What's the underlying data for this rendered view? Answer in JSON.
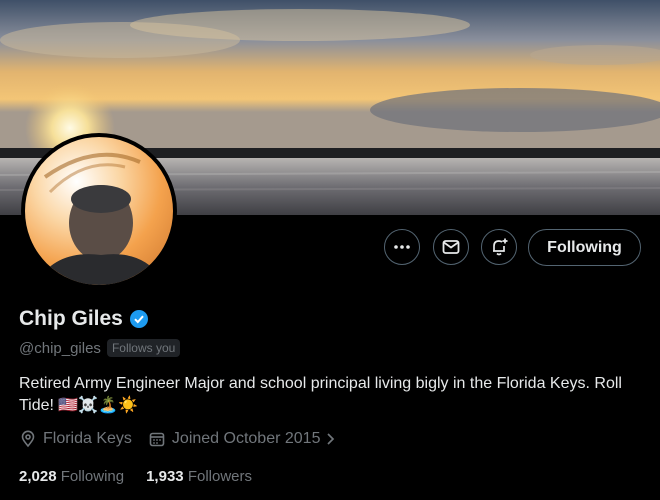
{
  "profile": {
    "name": "Chip Giles",
    "handle": "@chip_giles",
    "follows_you": "Follows you",
    "bio": "Retired Army Engineer Major and school principal living bigly in the Florida Keys. Roll Tide! 🇺🇸☠️🏝️☀️",
    "location": "Florida Keys",
    "joined": "Joined October 2015",
    "following_count": "2,028",
    "following_label": "Following",
    "followers_count": "1,933",
    "followers_label": "Followers",
    "verified": true
  },
  "actions": {
    "more_icon": "more-icon",
    "message_icon": "envelope-icon",
    "notify_icon": "bell-plus-icon",
    "follow_label": "Following"
  },
  "colors": {
    "background": "#000000",
    "text": "#e7e9ea",
    "muted": "#71767b",
    "verified": "#1d9bf0"
  }
}
